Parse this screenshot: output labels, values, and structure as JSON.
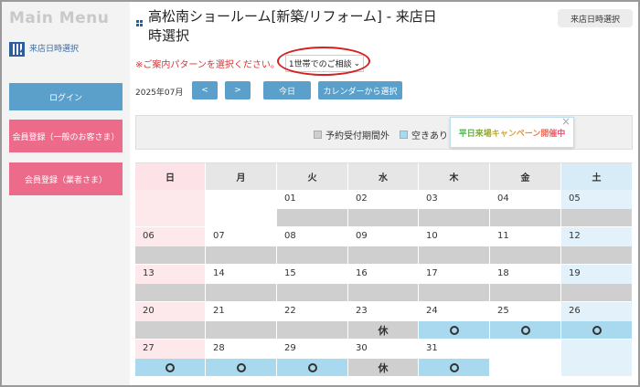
{
  "sidebar": {
    "menu_title": "Main Menu",
    "link_label": "来店日時選択",
    "login_label": "ログイン",
    "member_register_label": "会員登録（一般のお客さま）",
    "dealer_register_label": "会員登録（業者さま）"
  },
  "header": {
    "title": "高松南ショールーム[新築/リフォーム] - 来店日時選択",
    "top_right_button": "来店日時選択"
  },
  "pattern": {
    "label": "※ご案内パターンを選択ください。",
    "selected": "1世帯でのご相談"
  },
  "nav": {
    "month": "2025年07月",
    "prev": "<",
    "next": ">",
    "today": "今日",
    "calendar_select": "カレンダーから選択"
  },
  "legend": {
    "outside": "予約受付期間外",
    "available": "空きあり"
  },
  "campaign": {
    "text": "平日来場キャンペーン開催中",
    "close": "×"
  },
  "calendar": {
    "weekdays": [
      "日",
      "月",
      "火",
      "水",
      "木",
      "金",
      "土"
    ],
    "closed_mark": "休",
    "weeks": [
      [
        {
          "d": "",
          "s": "empty"
        },
        {
          "d": "",
          "s": "empty"
        },
        {
          "d": "01",
          "s": "gray"
        },
        {
          "d": "02",
          "s": "gray"
        },
        {
          "d": "03",
          "s": "gray"
        },
        {
          "d": "04",
          "s": "gray"
        },
        {
          "d": "05",
          "s": "gray"
        }
      ],
      [
        {
          "d": "06",
          "s": "gray"
        },
        {
          "d": "07",
          "s": "gray"
        },
        {
          "d": "08",
          "s": "gray"
        },
        {
          "d": "09",
          "s": "gray"
        },
        {
          "d": "10",
          "s": "gray"
        },
        {
          "d": "11",
          "s": "gray"
        },
        {
          "d": "12",
          "s": "gray"
        }
      ],
      [
        {
          "d": "13",
          "s": "gray"
        },
        {
          "d": "14",
          "s": "gray"
        },
        {
          "d": "15",
          "s": "gray"
        },
        {
          "d": "16",
          "s": "gray"
        },
        {
          "d": "17",
          "s": "gray"
        },
        {
          "d": "18",
          "s": "gray"
        },
        {
          "d": "19",
          "s": "gray"
        }
      ],
      [
        {
          "d": "20",
          "s": "gray"
        },
        {
          "d": "21",
          "s": "gray"
        },
        {
          "d": "22",
          "s": "gray"
        },
        {
          "d": "23",
          "s": "closed"
        },
        {
          "d": "24",
          "s": "open"
        },
        {
          "d": "25",
          "s": "open"
        },
        {
          "d": "26",
          "s": "open"
        }
      ],
      [
        {
          "d": "27",
          "s": "open"
        },
        {
          "d": "28",
          "s": "open"
        },
        {
          "d": "29",
          "s": "open"
        },
        {
          "d": "30",
          "s": "closed"
        },
        {
          "d": "31",
          "s": "open"
        },
        {
          "d": "",
          "s": "empty"
        },
        {
          "d": "",
          "s": "empty"
        }
      ]
    ]
  }
}
